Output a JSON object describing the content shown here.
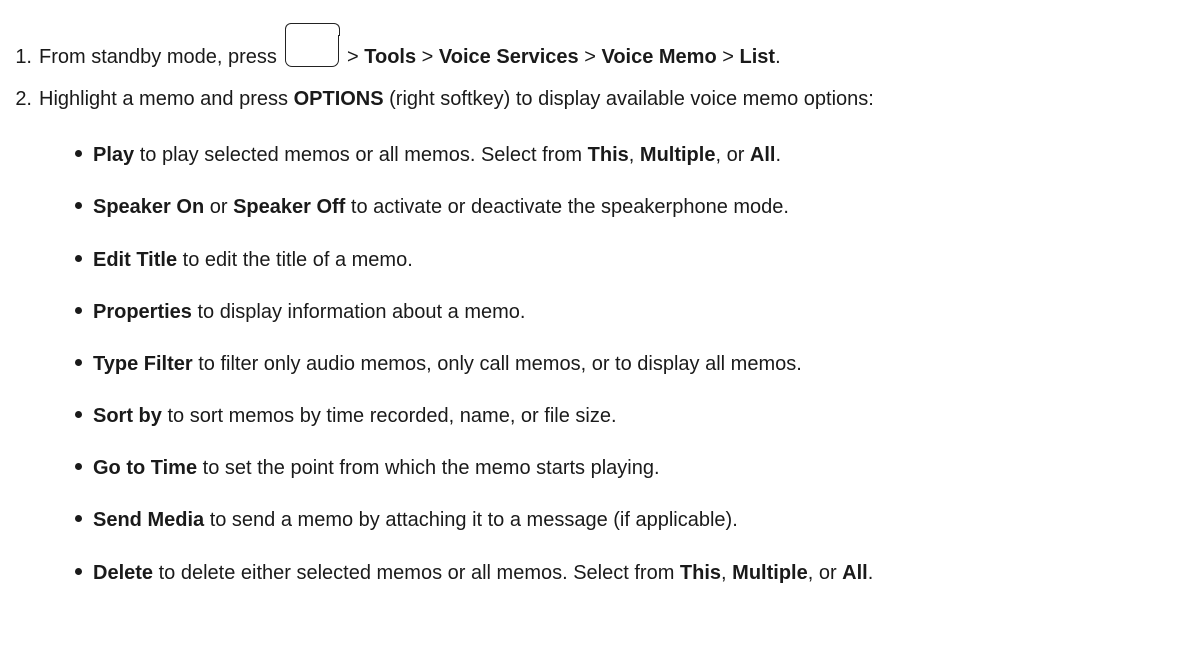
{
  "steps": [
    {
      "number": "1.",
      "prefix": "From standby mode, press",
      "sep": ">",
      "path": [
        "Tools",
        "Voice Services",
        "Voice Memo",
        "List"
      ],
      "end": "."
    },
    {
      "number": "2.",
      "text_a": "Highlight a memo and press ",
      "key": "OPTIONS",
      "text_b": " (right softkey) to display available voice memo options:"
    }
  ],
  "options": [
    {
      "term": "Play",
      "desc": " to play selected memos or all memos. Select from ",
      "choices": [
        "This",
        "Multiple",
        "All"
      ]
    },
    {
      "term": "Speaker On",
      "joiner": " or ",
      "term2": "Speaker Off",
      "desc": " to activate or deactivate the speakerphone mode."
    },
    {
      "term": "Edit Title",
      "desc": " to edit the title of a memo."
    },
    {
      "term": "Properties",
      "desc": " to display information about a memo."
    },
    {
      "term": "Type Filter",
      "desc": " to filter only audio memos, only call memos, or to display all memos."
    },
    {
      "term": "Sort by",
      "desc": " to sort memos by time recorded, name, or file size."
    },
    {
      "term": "Go to Time",
      "desc": " to set the point from which the memo starts playing."
    },
    {
      "term": "Send Media",
      "desc": " to send a memo by attaching it to a message (if applicable)."
    },
    {
      "term": "Delete",
      "desc": " to delete either selected memos or all memos. Select from ",
      "choices": [
        "This",
        "Multiple",
        "All"
      ]
    }
  ],
  "choice_sep": ", ",
  "choice_or": ", or ",
  "period": "."
}
